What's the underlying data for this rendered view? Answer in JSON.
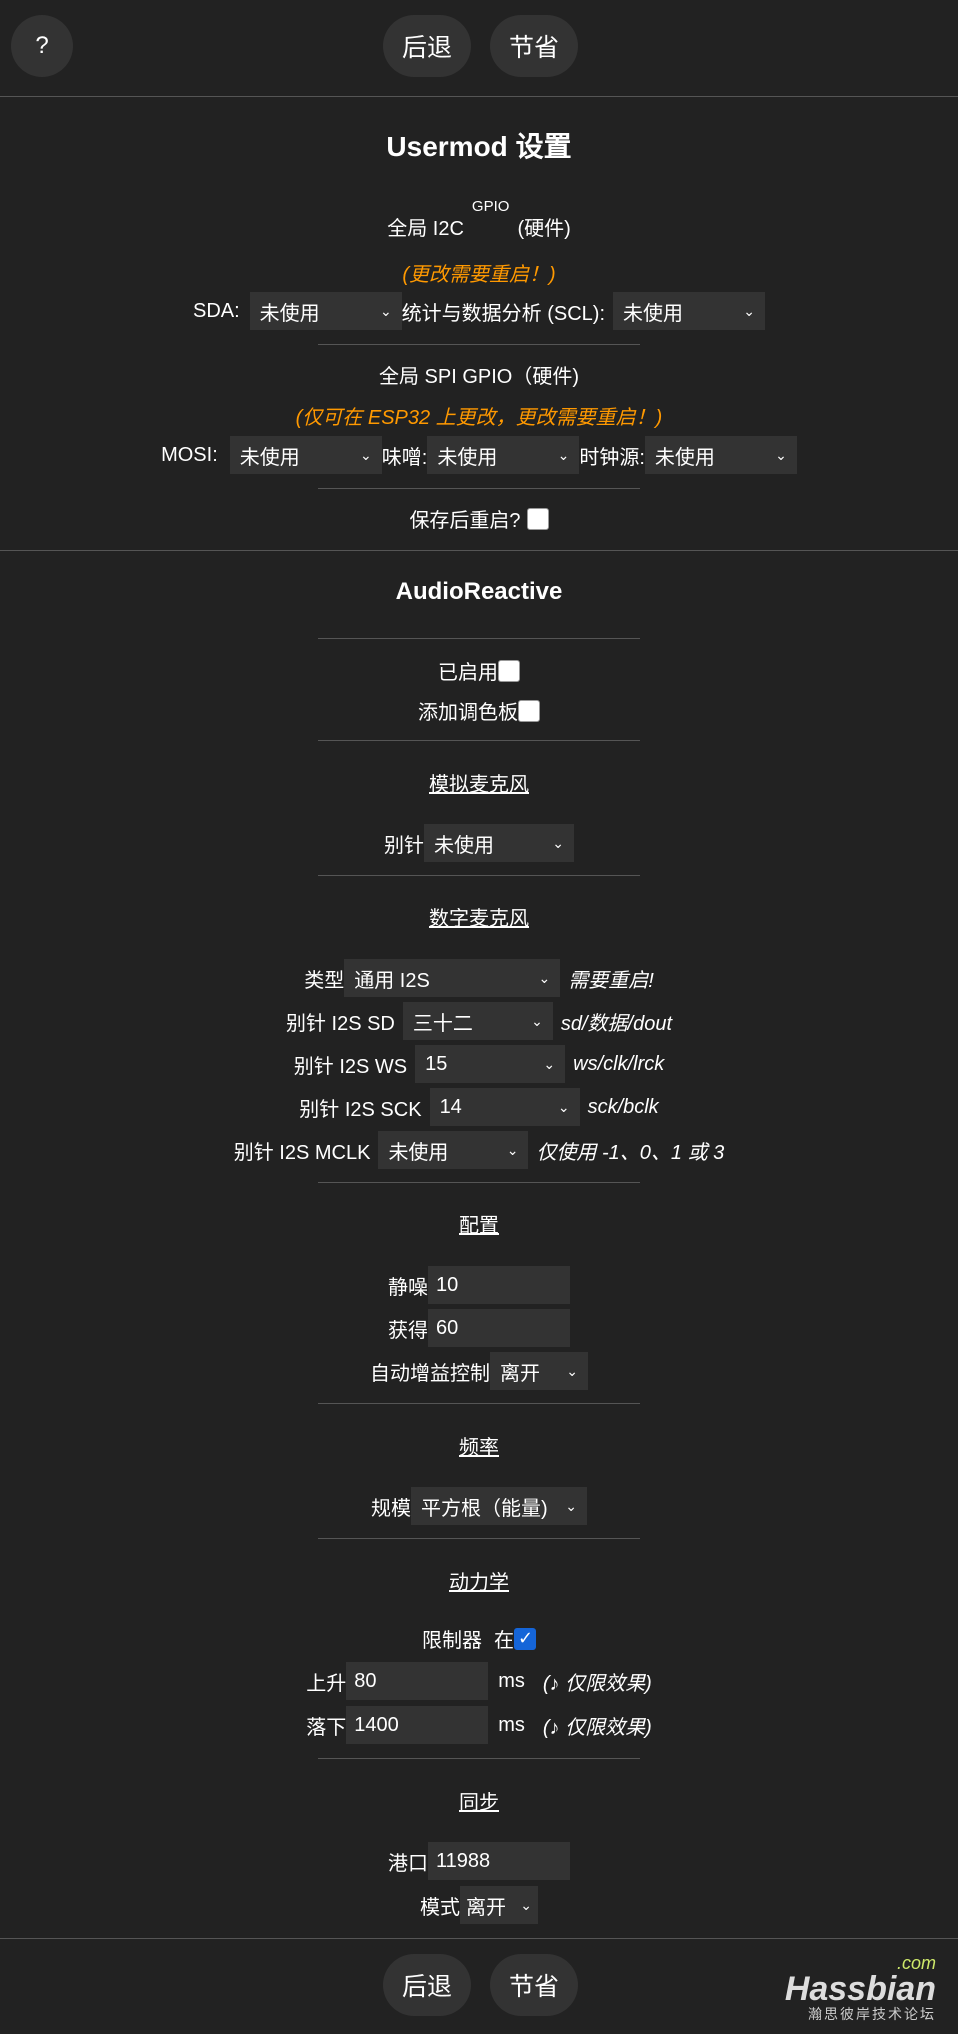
{
  "nav": {
    "help": "?",
    "back": "后退",
    "save": "节省"
  },
  "usermod": {
    "title": "Usermod 设置",
    "i2c_prefix": "全局 I2C",
    "i2c_sup": "GPIO",
    "i2c_suffix": "(硬件)",
    "i2c_warn": "(更改需要重启！)",
    "sda_label": "SDA:",
    "sda_value": "未使用",
    "scl_label": "统计与数据分析 (SCL):",
    "scl_value": "未使用",
    "spi_title": "全局 SPI GPIO（硬件)",
    "spi_warn": "(仅可在 ESP32 上更改，更改需要重启！)",
    "mosi_label": "MOSI:",
    "mosi_value": "未使用",
    "miso_label": "味噌:",
    "miso_value": "未使用",
    "clk_label": "时钟源:",
    "clk_value": "未使用",
    "reboot_label": "保存后重启?"
  },
  "audio": {
    "title": "AudioReactive",
    "enabled_label": "已启用",
    "palette_label": "添加调色板",
    "analog_head": "模拟麦克风",
    "analog_pin_label": "别针",
    "analog_pin_value": "未使用",
    "digital_head": "数字麦克风",
    "type_label": "类型",
    "type_value": "通用 I2S",
    "type_note": "需要重启!",
    "sd_label": "别针 I2S SD",
    "sd_value": "三十二",
    "sd_note": "sd/数据/dout",
    "ws_label": "别针 I2S WS",
    "ws_value": "15",
    "ws_note": "ws/clk/lrck",
    "sck_label": "别针 I2S SCK",
    "sck_value": "14",
    "sck_note": "sck/bclk",
    "mclk_label": "别针 I2S MCLK",
    "mclk_value": "未使用",
    "mclk_note": "仅使用 -1、0、1 或 3",
    "config_head": "配置",
    "squelch_label": "静噪",
    "squelch_value": "10",
    "gain_label": "获得",
    "gain_value": "60",
    "agc_label": "自动增益控制",
    "agc_value": "离开",
    "freq_head": "频率",
    "scale_label": "规模",
    "scale_value": "平方根（能量)",
    "dyn_head": "动力学",
    "limiter_label": "限制器",
    "limiter_on": "在",
    "rise_label": "上升",
    "rise_value": "80",
    "rise_unit": "ms",
    "rise_note": "(♪ 仅限效果)",
    "fall_label": "落下",
    "fall_value": "1400",
    "fall_unit": "ms",
    "fall_note": "(♪ 仅限效果)",
    "sync_head": "同步",
    "port_label": "港口",
    "port_value": "11988",
    "mode_label": "模式",
    "mode_value": "离开"
  },
  "watermark": {
    "com": ".com",
    "name": "Hassbian",
    "sub": "瀚思彼岸技术论坛"
  }
}
